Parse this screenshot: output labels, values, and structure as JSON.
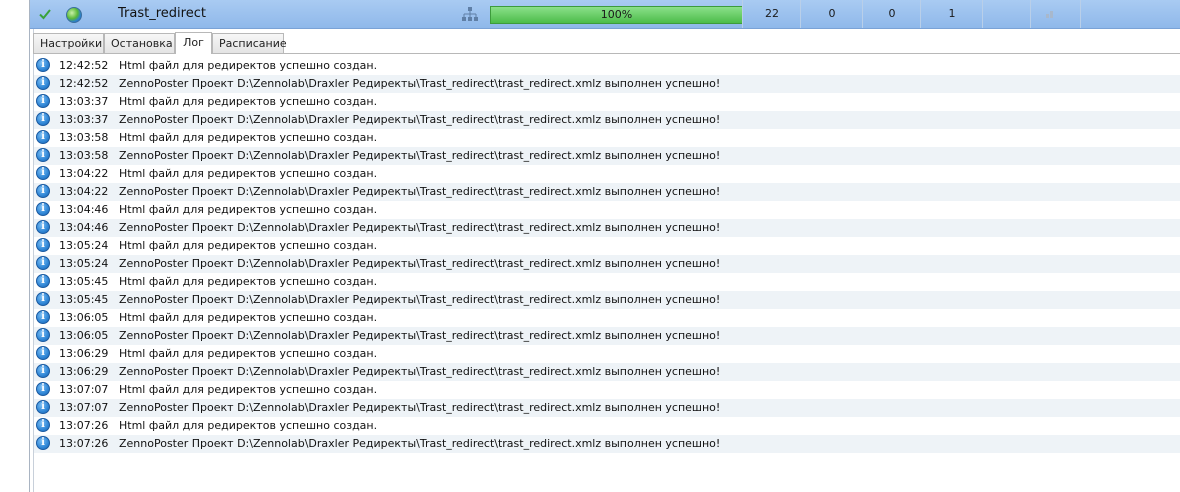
{
  "task": {
    "name": "Trast_redirect",
    "progress_label": "100%",
    "progress": 1.0,
    "count_1": "22",
    "count_2": "0",
    "count_3": "0",
    "count_4": "1"
  },
  "tabs": [
    {
      "label": "Настройки",
      "active": false
    },
    {
      "label": "Остановка",
      "active": false
    },
    {
      "label": "Лог",
      "active": true
    },
    {
      "label": "Расписание",
      "active": false
    }
  ],
  "log": [
    {
      "time": "12:42:52",
      "message": "Html файл для редиректов успешно создан."
    },
    {
      "time": "12:42:52",
      "message": "ZennoPoster Проект D:\\Zennolab\\Draxler Редиректы\\Trast_redirect\\trast_redirect.xmlz выполнен успешно!"
    },
    {
      "time": "13:03:37",
      "message": "Html файл для редиректов успешно создан."
    },
    {
      "time": "13:03:37",
      "message": "ZennoPoster Проект D:\\Zennolab\\Draxler Редиректы\\Trast_redirect\\trast_redirect.xmlz выполнен успешно!"
    },
    {
      "time": "13:03:58",
      "message": "Html файл для редиректов успешно создан."
    },
    {
      "time": "13:03:58",
      "message": "ZennoPoster Проект D:\\Zennolab\\Draxler Редиректы\\Trast_redirect\\trast_redirect.xmlz выполнен успешно!"
    },
    {
      "time": "13:04:22",
      "message": "Html файл для редиректов успешно создан."
    },
    {
      "time": "13:04:22",
      "message": "ZennoPoster Проект D:\\Zennolab\\Draxler Редиректы\\Trast_redirect\\trast_redirect.xmlz выполнен успешно!"
    },
    {
      "time": "13:04:46",
      "message": "Html файл для редиректов успешно создан."
    },
    {
      "time": "13:04:46",
      "message": "ZennoPoster Проект D:\\Zennolab\\Draxler Редиректы\\Trast_redirect\\trast_redirect.xmlz выполнен успешно!"
    },
    {
      "time": "13:05:24",
      "message": "Html файл для редиректов успешно создан."
    },
    {
      "time": "13:05:24",
      "message": "ZennoPoster Проект D:\\Zennolab\\Draxler Редиректы\\Trast_redirect\\trast_redirect.xmlz выполнен успешно!"
    },
    {
      "time": "13:05:45",
      "message": "Html файл для редиректов успешно создан."
    },
    {
      "time": "13:05:45",
      "message": "ZennoPoster Проект D:\\Zennolab\\Draxler Редиректы\\Trast_redirect\\trast_redirect.xmlz выполнен успешно!"
    },
    {
      "time": "13:06:05",
      "message": "Html файл для редиректов успешно создан."
    },
    {
      "time": "13:06:05",
      "message": "ZennoPoster Проект D:\\Zennolab\\Draxler Редиректы\\Trast_redirect\\trast_redirect.xmlz выполнен успешно!"
    },
    {
      "time": "13:06:29",
      "message": "Html файл для редиректов успешно создан."
    },
    {
      "time": "13:06:29",
      "message": "ZennoPoster Проект D:\\Zennolab\\Draxler Редиректы\\Trast_redirect\\trast_redirect.xmlz выполнен успешно!"
    },
    {
      "time": "13:07:07",
      "message": "Html файл для редиректов успешно создан."
    },
    {
      "time": "13:07:07",
      "message": "ZennoPoster Проект D:\\Zennolab\\Draxler Редиректы\\Trast_redirect\\trast_redirect.xmlz выполнен успешно!"
    },
    {
      "time": "13:07:26",
      "message": "Html файл для редиректов успешно создан."
    },
    {
      "time": "13:07:26",
      "message": "ZennoPoster Проект D:\\Zennolab\\Draxler Редиректы\\Trast_redirect\\trast_redirect.xmlz выполнен успешно!"
    }
  ],
  "icons": {
    "status": "check-icon",
    "type": "globe-icon",
    "network": "network-icon",
    "log_entry": "info-icon",
    "extra": "signal-icon"
  },
  "colors": {
    "selected_row": "#9fc3ef",
    "progress": "#4cbc4a",
    "info": "#2f86d6"
  }
}
